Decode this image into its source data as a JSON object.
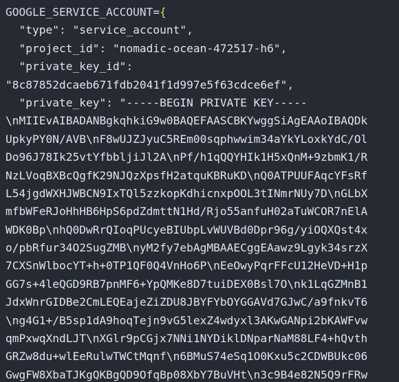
{
  "editor": {
    "language": "env",
    "theme": {
      "background": "#252a33",
      "text": "#d7dde7",
      "brace": "#f2d04a"
    },
    "lines": [
      {
        "indent": "",
        "parts": [
          {
            "t": "GOOGLE_SERVICE_ACCOUNT=",
            "c": "var"
          },
          {
            "t": "{",
            "c": "brace"
          }
        ]
      },
      {
        "indent": "  ",
        "parts": [
          {
            "t": "\"type\"",
            "c": "str"
          },
          {
            "t": ": ",
            "c": "punct"
          },
          {
            "t": "\"service_account\"",
            "c": "str"
          },
          {
            "t": ",",
            "c": "punct"
          }
        ]
      },
      {
        "indent": "  ",
        "parts": [
          {
            "t": "\"project_id\"",
            "c": "str"
          },
          {
            "t": ": ",
            "c": "punct"
          },
          {
            "t": "\"nomadic-ocean-472517-h6\"",
            "c": "str"
          },
          {
            "t": ",",
            "c": "punct"
          }
        ]
      },
      {
        "indent": "  ",
        "parts": [
          {
            "t": "\"private_key_id\"",
            "c": "str"
          },
          {
            "t": ":",
            "c": "punct"
          }
        ]
      },
      {
        "indent": "",
        "parts": [
          {
            "t": "\"8c87852dcaeb671fdb2041f1d997e5f63cdce6ef\"",
            "c": "str"
          },
          {
            "t": ",",
            "c": "punct"
          }
        ]
      },
      {
        "indent": "  ",
        "parts": [
          {
            "t": "\"private_key\"",
            "c": "str"
          },
          {
            "t": ": ",
            "c": "punct"
          },
          {
            "t": "\"-----BEGIN PRIVATE KEY-----",
            "c": "str"
          }
        ]
      },
      {
        "indent": "",
        "parts": [
          {
            "t": "\\nMIIEvAIBADANBgkqhkiG9w0BAQEFAASCBKYwggSiAgEAAoIBAQDk",
            "c": "str"
          }
        ]
      },
      {
        "indent": "",
        "parts": [
          {
            "t": "UpkyPY0N/AVB\\nF8wUJZJyuC5REm00sqphwwim34aYkYLoxkYdC/Ol",
            "c": "str"
          }
        ]
      },
      {
        "indent": "",
        "parts": [
          {
            "t": "Do96J78Ik25vtYfbbljiJl2A\\nPf/h1qQQYHIk1H5xQnM+9zbmK1/R",
            "c": "str"
          }
        ]
      },
      {
        "indent": "",
        "parts": [
          {
            "t": "NzLVoqBXBcQgfK29NJQzXpsfH2atquKBRuKD\\nQ0ATPUUFAqcYFsRf",
            "c": "str"
          }
        ]
      },
      {
        "indent": "",
        "parts": [
          {
            "t": "L54jgdWXHJWBCN9IxTQl5zzkopKdhicnxpOOL3tINmrNUy7D\\nGLbX",
            "c": "str"
          }
        ]
      },
      {
        "indent": "",
        "parts": [
          {
            "t": "mfbWFeRJoHhHB6HpS6pdZdmttN1Hd/Rjo55anfuH02aTuWCOR7nElA",
            "c": "str"
          }
        ]
      },
      {
        "indent": "",
        "parts": [
          {
            "t": "WDK0Bp\\nhQ0DwRrQIoqPUcyeBIUbpLvWUVBd0Dpr96g/yiOQXQst4x",
            "c": "str"
          }
        ]
      },
      {
        "indent": "",
        "parts": [
          {
            "t": "o/pbRfur34O2SugZMB\\nyM2fy7ebAgMBAAECggEAawz9Lgyk34srzX",
            "c": "str"
          }
        ]
      },
      {
        "indent": "",
        "parts": [
          {
            "t": "7CXSnWlbocYT+h+0TP1QF0Q4VnHo6P\\nEeOwyPqrFFcU12HeVD+H1p",
            "c": "str"
          }
        ]
      },
      {
        "indent": "",
        "parts": [
          {
            "t": "GG7s+4leQGD9RB7pnMF6+YpQMKe8D7tuiDEX0Bsl7O\\nk1LqGZMnB1",
            "c": "str"
          }
        ]
      },
      {
        "indent": "",
        "parts": [
          {
            "t": "JdxWnrGIDBe2CmLEQEajeZiZDU8JBYFYbOYGGAVd7GJwC/a9fnkvT6",
            "c": "str"
          }
        ]
      },
      {
        "indent": "",
        "parts": [
          {
            "t": "\\ng4G1+/B5sp1dA9hoqTejn9vG5lexZ4wdyxl3AKwGANpi2bKAWFvw",
            "c": "str"
          }
        ]
      },
      {
        "indent": "",
        "parts": [
          {
            "t": "qmPxwqXndLJT\\nXGlr9pCGjx7NNi1NYDiklDNparNaM88LF4+hQvth",
            "c": "str"
          }
        ]
      },
      {
        "indent": "",
        "parts": [
          {
            "t": "GRZw8du+wlEeRulwTWCtMqnf\\n6BMuS74eSq1O0Kxu5c2CDWBUkc06",
            "c": "str"
          }
        ]
      },
      {
        "indent": "",
        "parts": [
          {
            "t": "GwgFW8XbaTJKgQKBgQD9OfqBp08XbY7BuVHt\\n3c9B4e82N5Q9rFRw",
            "c": "str"
          }
        ]
      }
    ]
  }
}
